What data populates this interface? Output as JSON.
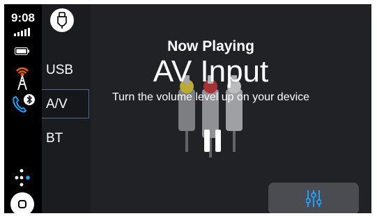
{
  "status": {
    "time": "9:08"
  },
  "sources": {
    "items": [
      {
        "label": "USB",
        "active": false
      },
      {
        "label": "A/V",
        "active": true
      },
      {
        "label": "BT",
        "active": false
      }
    ]
  },
  "now_playing": {
    "header": "Now Playing",
    "source_title": "AV Input",
    "instruction": "Turn the volume level up on your device",
    "playback_state": "paused"
  },
  "colors": {
    "background": "#202226",
    "rail": "#000000",
    "accent": "#1aa3ff",
    "eq_button": "#4a4c52",
    "cable_yellow": "#d8c23a",
    "cable_red": "#c0333b",
    "cable_white": "#d9d9d9"
  },
  "icons": {
    "rail": [
      "signal-bars-icon",
      "battery-icon",
      "radio-tower-icon",
      "phone-bluetooth-icon",
      "launcher-dots-icon",
      "home-button-icon"
    ],
    "app": "aux-jack-icon",
    "controls": [
      "pause-icon",
      "equalizer-icon"
    ]
  }
}
